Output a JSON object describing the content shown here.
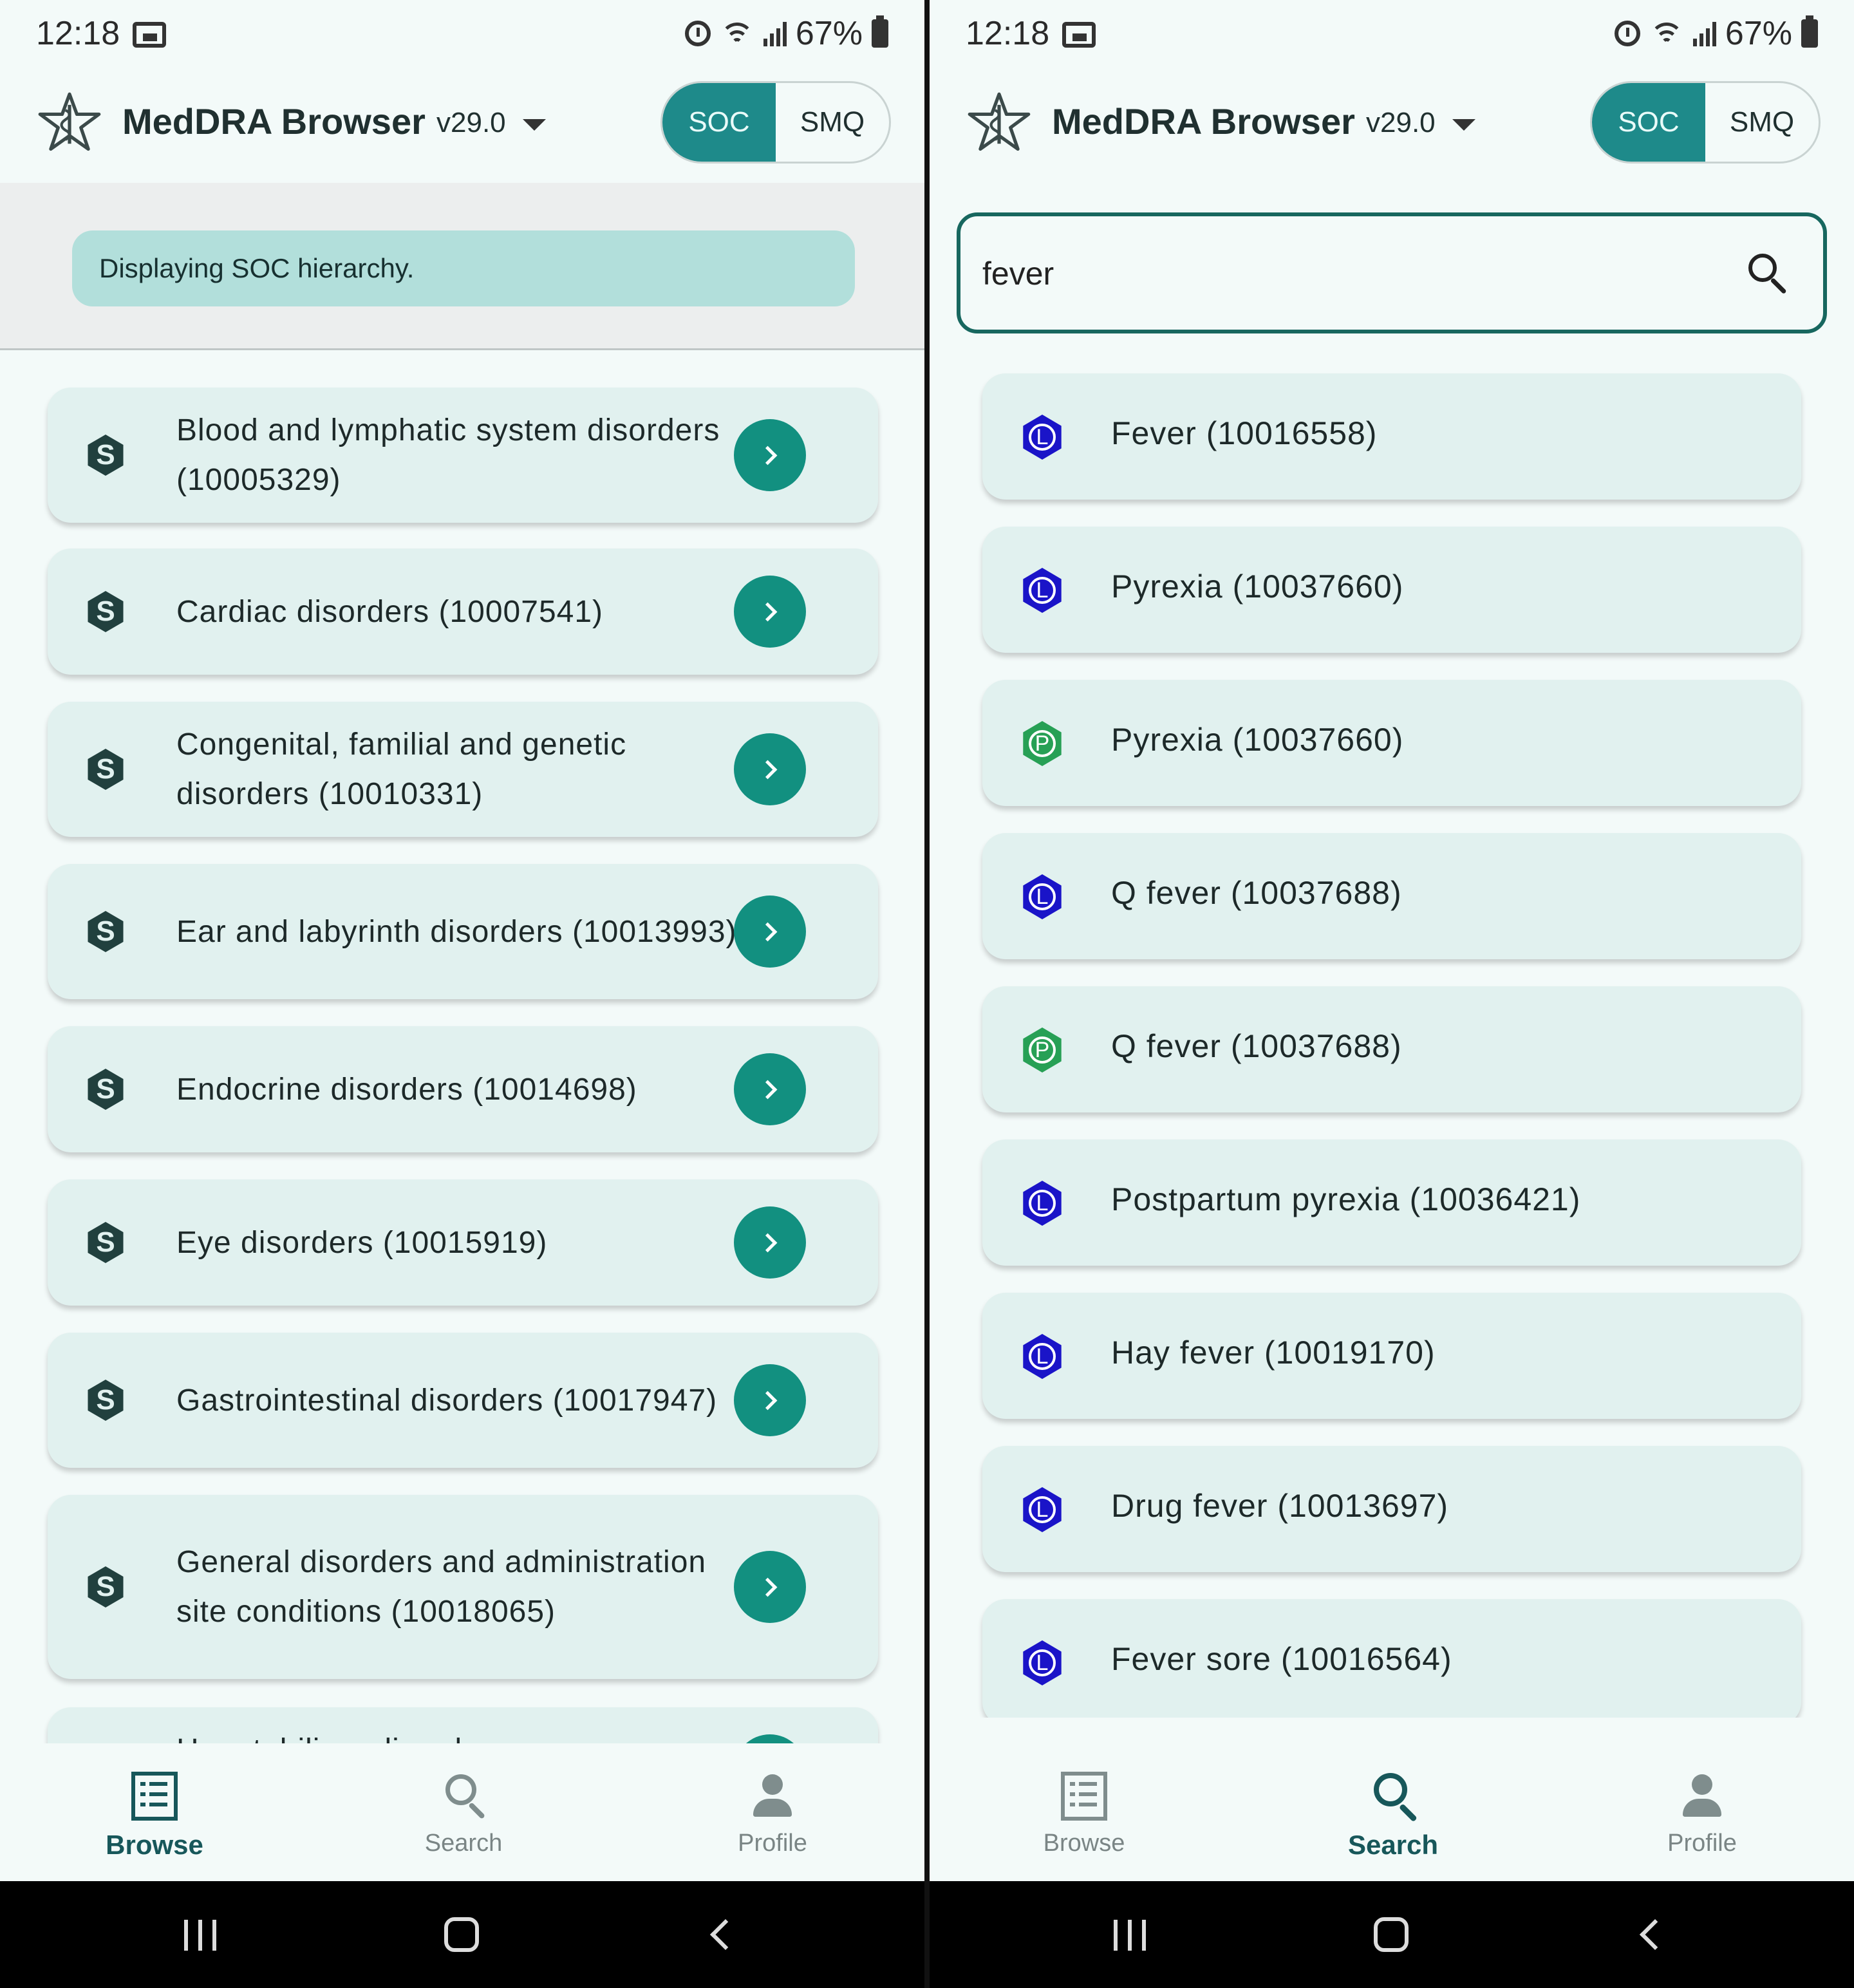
{
  "status_bar": {
    "time": "12:18",
    "battery": "67%"
  },
  "app": {
    "title": "MedDRA Browser",
    "version": "v29.0",
    "segments": [
      "SOC",
      "SMQ"
    ],
    "active_segment": "SOC",
    "accent_color": "#1e8a8a"
  },
  "left": {
    "info_banner": "Displaying SOC hierarchy.",
    "soc_badge": "S",
    "items": [
      {
        "label": "Blood and lymphatic system disorders (10005329)"
      },
      {
        "label": "Cardiac disorders (10007541)"
      },
      {
        "label": "Congenital, familial and genetic disorders (10010331)"
      },
      {
        "label": "Ear and labyrinth disorders (10013993)"
      },
      {
        "label": "Endocrine disorders (10014698)"
      },
      {
        "label": "Eye disorders (10015919)"
      },
      {
        "label": "Gastrointestinal disorders (10017947)"
      },
      {
        "label": "General disorders and administration site conditions (10018065)"
      },
      {
        "label": "Hepatobiliary disorders"
      }
    ]
  },
  "right": {
    "search": {
      "value": "fever"
    },
    "results": [
      {
        "level": "L",
        "label": "Fever (10016558)"
      },
      {
        "level": "L",
        "label": "Pyrexia (10037660)"
      },
      {
        "level": "P",
        "label": "Pyrexia (10037660)"
      },
      {
        "level": "L",
        "label": "Q fever (10037688)"
      },
      {
        "level": "P",
        "label": "Q fever (10037688)"
      },
      {
        "level": "L",
        "label": "Postpartum pyrexia (10036421)"
      },
      {
        "level": "L",
        "label": "Hay fever (10019170)"
      },
      {
        "level": "L",
        "label": "Drug fever (10013697)"
      },
      {
        "level": "L",
        "label": "Fever sore (10016564)"
      }
    ]
  },
  "nav": {
    "browse": "Browse",
    "search": "Search",
    "profile": "Profile"
  },
  "icons": {
    "logo": "star-of-life-icon",
    "soc": "soc-hexagon-icon",
    "llt": "llt-hexagon-icon",
    "pt": "pt-hexagon-icon"
  }
}
